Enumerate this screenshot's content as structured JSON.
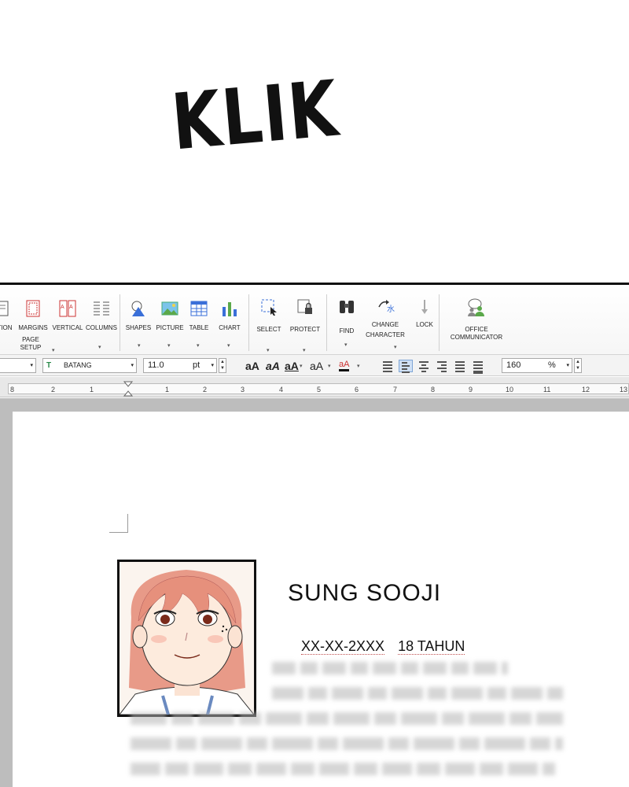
{
  "comic": {
    "sfx": "KLIK"
  },
  "ribbon": {
    "groups": [
      {
        "items": [
          "TION",
          "MARGINS",
          "VERTICAL",
          "COLUMNS"
        ],
        "group_label": "PAGE\nSETUP"
      },
      {
        "items": [
          "SHAPES",
          "PICTURE",
          "TABLE",
          "CHART"
        ]
      },
      {
        "items": [
          "SELECT",
          "PROTECT"
        ]
      },
      {
        "items": [
          "FIND",
          "CHANGE CHARACTER",
          "LOCK"
        ]
      },
      {
        "items": [
          "OFFICE COMMUNICATOR"
        ]
      }
    ],
    "labels": {
      "tion": "TION",
      "margins": "MARGINS",
      "vertical": "VERTICAL",
      "columns": "COLUMNS",
      "page_setup_1": "PAGE",
      "page_setup_2": "SETUP",
      "shapes": "SHAPES",
      "picture": "PICTURE",
      "table": "TABLE",
      "chart": "CHART",
      "select": "SELECT",
      "protect": "PROTECT",
      "find": "FIND",
      "change_1": "CHANGE",
      "change_2": "CHARACTER",
      "lock": "LOCK",
      "office_1": "OFFICE",
      "office_2": "COMMUNICATOR"
    }
  },
  "format_bar": {
    "font_name": "BATANG",
    "font_size": "11.0",
    "font_unit": "pt",
    "style_buttons": [
      "aA",
      "aA",
      "aA",
      "aA",
      "aA"
    ],
    "zoom": "160",
    "zoom_unit": "%"
  },
  "ruler": {
    "numbers": [
      "8",
      "2",
      "1",
      "1",
      "2",
      "3",
      "4",
      "5",
      "6",
      "7",
      "8",
      "9",
      "10",
      "11",
      "12",
      "13"
    ]
  },
  "document": {
    "name": "SUNG SOOJI",
    "birthdate": "XX-XX-2XXX",
    "age": "18 TAHUN"
  },
  "colors": {
    "accent_blue": "#cfe0f5",
    "underline_red": "#c05050",
    "hair": "#e08c7a"
  }
}
